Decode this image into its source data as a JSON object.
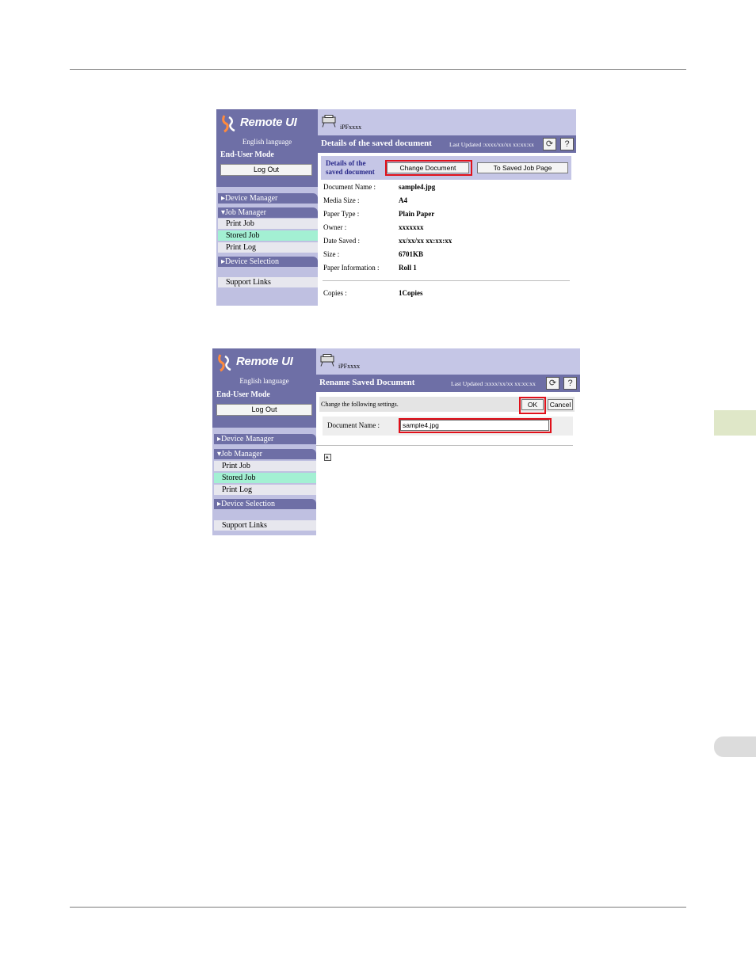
{
  "screen1": {
    "logo_text": "Remote UI",
    "language": "English language",
    "mode": "End-User Mode",
    "logout_label": "Log Out",
    "nav": {
      "device_manager": "Device Manager",
      "job_manager": "Job Manager",
      "print_job": "Print Job",
      "stored_job": "Stored Job",
      "print_log": "Print Log",
      "device_selection": "Device Selection",
      "support_links": "Support Links"
    },
    "printer_name": "iPFxxxx",
    "title": "Details of the saved document",
    "last_updated": "Last Updated :xxxx/xx/xx xx:xx:xx",
    "refresh_icon": "refresh-icon",
    "help_label": "?",
    "section_label_line1": "Details of the",
    "section_label_line2": "saved document",
    "change_document_label": "Change Document",
    "to_saved_job_label": "To Saved Job Page",
    "fields": [
      {
        "label": "Document Name :",
        "value": "sample4.jpg"
      },
      {
        "label": "Media Size :",
        "value": "A4"
      },
      {
        "label": "Paper Type :",
        "value": "Plain Paper"
      },
      {
        "label": "Owner :",
        "value": "xxxxxxx"
      },
      {
        "label": "Date Saved :",
        "value": "xx/xx/xx xx:xx:xx"
      },
      {
        "label": "Size :",
        "value": "6701KB"
      },
      {
        "label": "Paper Information :",
        "value": "Roll 1"
      }
    ],
    "copies_label": "Copies :",
    "copies_value": "1Copies"
  },
  "screen2": {
    "logo_text": "Remote UI",
    "language": "English language",
    "mode": "End-User Mode",
    "logout_label": "Log Out",
    "nav": {
      "device_manager": "Device Manager",
      "job_manager": "Job Manager",
      "print_job": "Print Job",
      "stored_job": "Stored Job",
      "print_log": "Print Log",
      "device_selection": "Device Selection",
      "support_links": "Support Links"
    },
    "printer_name": "iPFxxxx",
    "title": "Rename Saved Document",
    "last_updated": "Last Updated :xxxx/xx/xx xx:xx:xx",
    "refresh_icon": "refresh-icon",
    "help_label": "?",
    "instruction": "Change the following settings.",
    "ok_label": "OK",
    "cancel_label": "Cancel",
    "doc_name_label": "Document Name :",
    "doc_name_value": "sample4.jpg"
  },
  "colors": {
    "sidebar_dark": "#6e6fa6",
    "sidebar_light": "#bfc0e1",
    "selected_item": "#a3f0d3",
    "highlight": "#e0101a"
  }
}
